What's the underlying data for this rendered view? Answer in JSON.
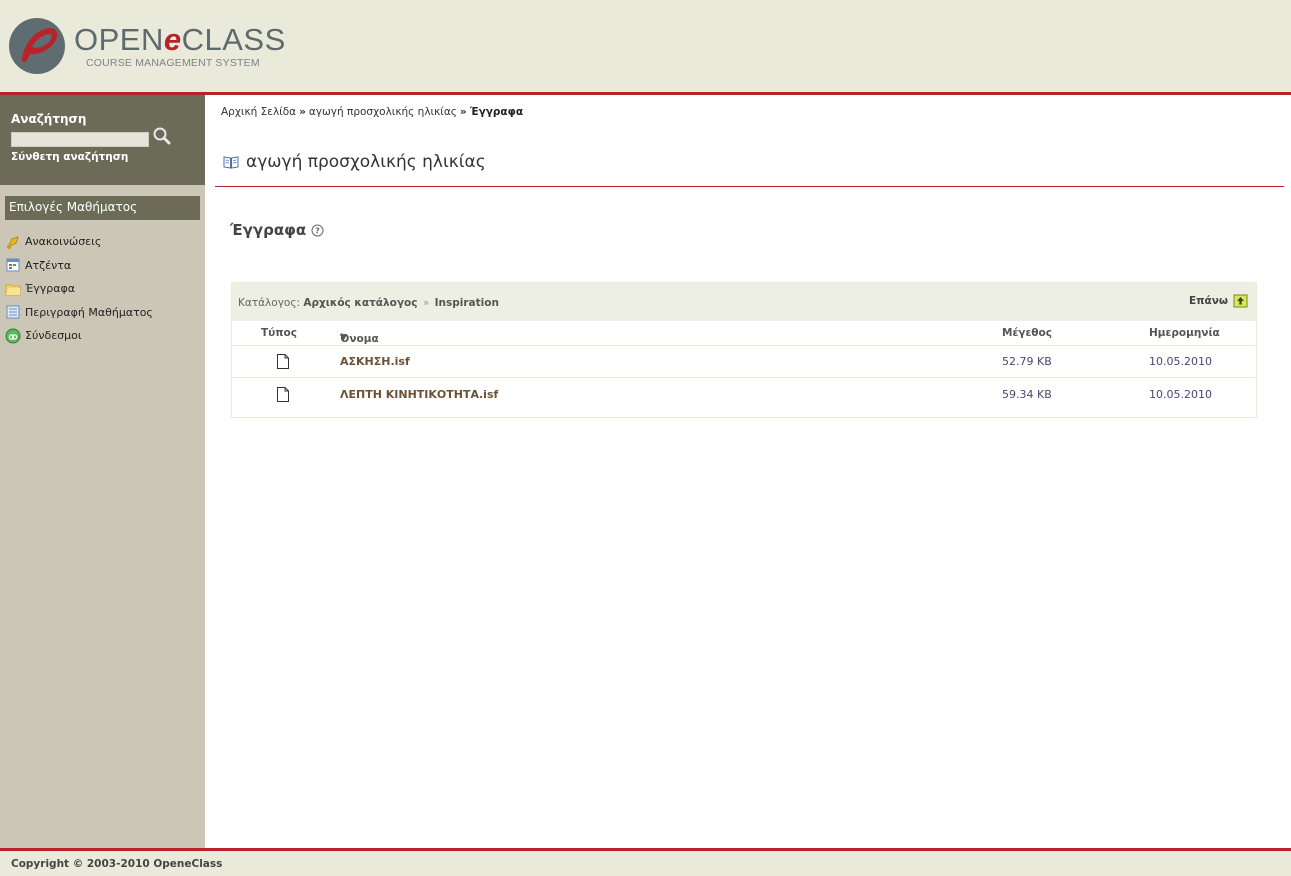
{
  "header": {
    "logo_title_pre": "OPEN",
    "logo_title_e": "e",
    "logo_title_post": "CLASS",
    "logo_subtitle": "COURSE MANAGEMENT SYSTEM"
  },
  "sidebar": {
    "search_title": "Αναζήτηση",
    "search_value": "",
    "advanced_search": "Σύνθετη αναζήτηση",
    "menu_title": "Επιλογές Μαθήματος",
    "items": [
      {
        "label": "Ανακοινώσεις",
        "icon": "announcements-icon"
      },
      {
        "label": "Ατζέντα",
        "icon": "calendar-icon"
      },
      {
        "label": "Έγγραφα",
        "icon": "folder-icon"
      },
      {
        "label": "Περιγραφή Μαθήματος",
        "icon": "description-icon"
      },
      {
        "label": "Σύνδεσμοι",
        "icon": "links-icon"
      }
    ]
  },
  "breadcrumb": {
    "home": "Αρχική Σελίδα",
    "course": "αγωγή προσχολικής ηλικίας",
    "current": "Έγγραφα",
    "separator": "»"
  },
  "course_title": "αγωγή προσχολικής ηλικίας",
  "section_title": "Έγγραφα",
  "documents": {
    "dir_label": "Κατάλογος:",
    "root_dir": "Αρχικός κατάλογος",
    "path_separator": "»",
    "current_dir": "Inspiration",
    "up_label": "Επάνω",
    "columns": {
      "type": "Τύπος",
      "name": "Όνομα",
      "size": "Μέγεθος",
      "date": "Ημερομηνία"
    },
    "sort_indicator": "▼",
    "files": [
      {
        "name": "ΑΣΚΗΣΗ.isf",
        "size": "52.79 KB",
        "date": "10.05.2010"
      },
      {
        "name": "ΛΕΠΤΗ ΚΙΝΗΤΙΚΟΤΗΤΑ.isf",
        "size": "59.34 KB",
        "date": "10.05.2010"
      }
    ]
  },
  "footer": {
    "copyright": "Copyright © 2003-2010 OpeneClass"
  },
  "colors": {
    "accent_red": "#b8232a",
    "header_bg": "#e9ead9",
    "sidebar_bg": "#cbc6b5",
    "sidebar_dark": "#6b6b58"
  }
}
